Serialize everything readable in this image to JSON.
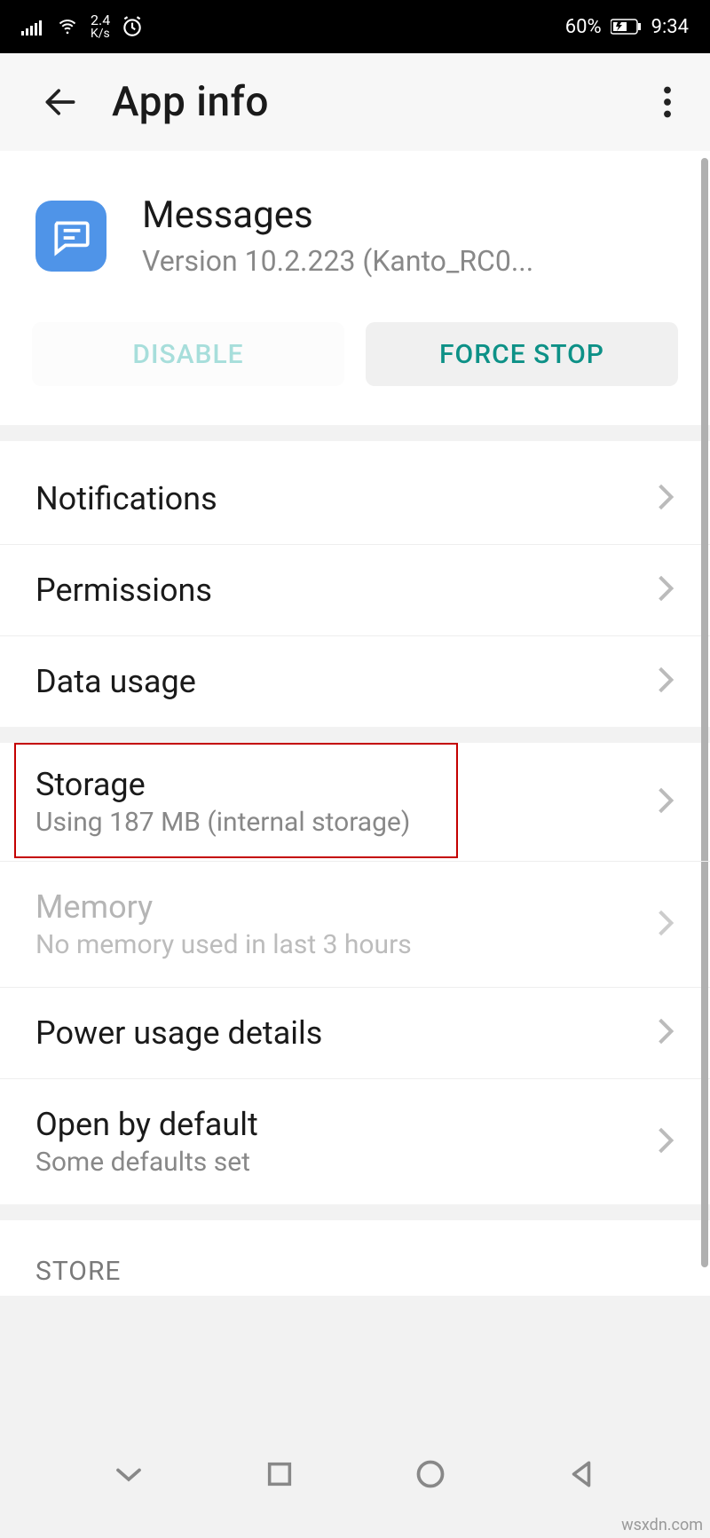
{
  "status": {
    "speed_top": "2.4",
    "speed_bottom": "K/s",
    "battery_pct": "60%",
    "time": "9:34"
  },
  "appbar": {
    "title": "App info"
  },
  "app": {
    "name": "Messages",
    "version": "Version 10.2.223 (Kanto_RC0..."
  },
  "buttons": {
    "disable": "DISABLE",
    "force_stop": "FORCE STOP"
  },
  "items": {
    "notifications": "Notifications",
    "permissions": "Permissions",
    "data_usage": "Data usage",
    "storage_title": "Storage",
    "storage_sub": "Using 187 MB (internal storage)",
    "memory_title": "Memory",
    "memory_sub": "No memory used in last 3 hours",
    "power": "Power usage details",
    "open_default_title": "Open by default",
    "open_default_sub": "Some defaults set"
  },
  "section": {
    "store": "STORE"
  },
  "watermark": "wsxdn.com"
}
